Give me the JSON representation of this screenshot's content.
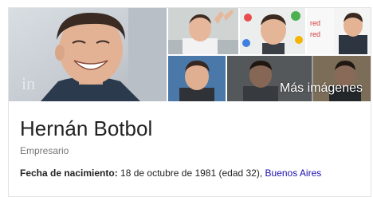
{
  "gallery": {
    "more_images_label": "Más imágenes",
    "watermark_text": "in"
  },
  "entity": {
    "name": "Hernán Botbol",
    "description": "Empresario"
  },
  "facts": [
    {
      "label": "Fecha de nacimiento:",
      "value": "18 de octubre de 1981 (edad 32),",
      "link": "Buenos Aires"
    }
  ],
  "colors": {
    "link": "#1a0dab",
    "title": "#222222",
    "muted": "#777777",
    "border": "#e4e4e4"
  }
}
